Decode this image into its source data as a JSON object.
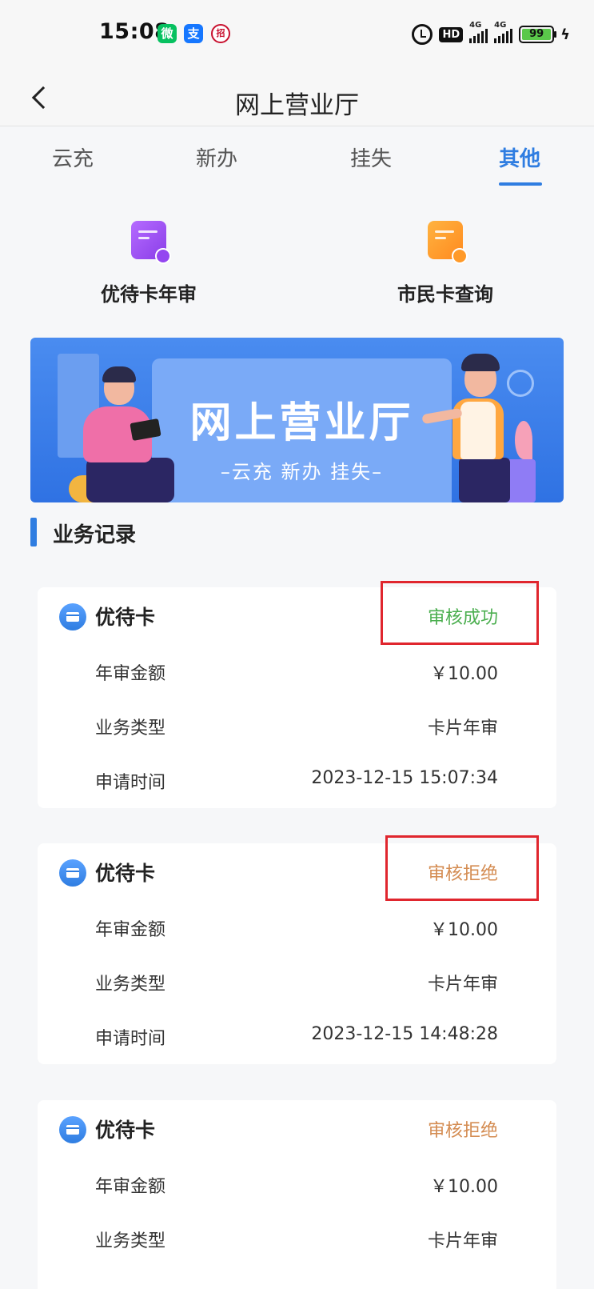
{
  "status_bar": {
    "time": "15:08",
    "hd": "HD",
    "net1": "4G",
    "net2": "4G",
    "battery": "99",
    "wechat": "微",
    "alipay": "支",
    "cmb": "招"
  },
  "nav": {
    "title": "网上营业厅"
  },
  "tabs": [
    {
      "label": "云充"
    },
    {
      "label": "新办"
    },
    {
      "label": "挂失"
    },
    {
      "label": "其他"
    }
  ],
  "active_tab": "其他",
  "quick_entries": [
    {
      "label": "优待卡年审",
      "icon": "review-document-icon"
    },
    {
      "label": "市民卡查询",
      "icon": "search-document-icon"
    }
  ],
  "banner": {
    "title": "网上营业厅",
    "subtitle": "–云充   新办   挂失–"
  },
  "section": {
    "title": "业务记录"
  },
  "records": [
    {
      "name": "优待卡",
      "status": "审核成功",
      "rows": [
        {
          "key": "年审金额",
          "value": "￥10.00"
        },
        {
          "key": "业务类型",
          "value": "卡片年审"
        },
        {
          "key": "申请时间",
          "value": "2023-12-15 15:07:34"
        }
      ]
    },
    {
      "name": "优待卡",
      "status": "审核拒绝",
      "rows": [
        {
          "key": "年审金额",
          "value": "￥10.00"
        },
        {
          "key": "业务类型",
          "value": "卡片年审"
        },
        {
          "key": "申请时间",
          "value": "2023-12-15 14:48:28"
        }
      ]
    },
    {
      "name": "优待卡",
      "status": "审核拒绝",
      "rows": [
        {
          "key": "年审金额",
          "value": "￥10.00"
        },
        {
          "key": "业务类型",
          "value": "卡片年审"
        }
      ]
    }
  ],
  "colors": {
    "accent": "#2f7de1",
    "success": "#4caf50",
    "reject": "#d48c52",
    "highlight": "#e0262e"
  }
}
